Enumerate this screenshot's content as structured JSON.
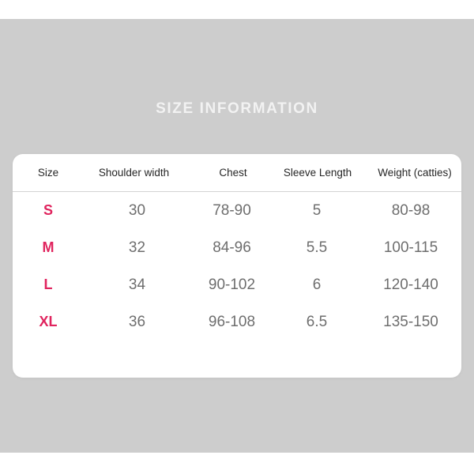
{
  "banner": {
    "title": "SIZE INFORMATION",
    "title_color": "#f2f2f2",
    "background_color": "#cdcdcd"
  },
  "card": {
    "background_color": "#ffffff"
  },
  "accent_color": "#e0245e",
  "header_text_color": "#262626",
  "value_text_color": "#6e6e6e",
  "size_table": {
    "columns": [
      "Size",
      "Shoulder width",
      "Chest",
      "Sleeve Length",
      "Weight (catties)"
    ],
    "rows": [
      {
        "size": "S",
        "shoulder_width": "30",
        "chest": "78-90",
        "sleeve_length": "5",
        "weight": "80-98"
      },
      {
        "size": "M",
        "shoulder_width": "32",
        "chest": "84-96",
        "sleeve_length": "5.5",
        "weight": "100-115"
      },
      {
        "size": "L",
        "shoulder_width": "34",
        "chest": "90-102",
        "sleeve_length": "6",
        "weight": "120-140"
      },
      {
        "size": "XL",
        "shoulder_width": "36",
        "chest": "96-108",
        "sleeve_length": "6.5",
        "weight": "135-150"
      }
    ]
  }
}
